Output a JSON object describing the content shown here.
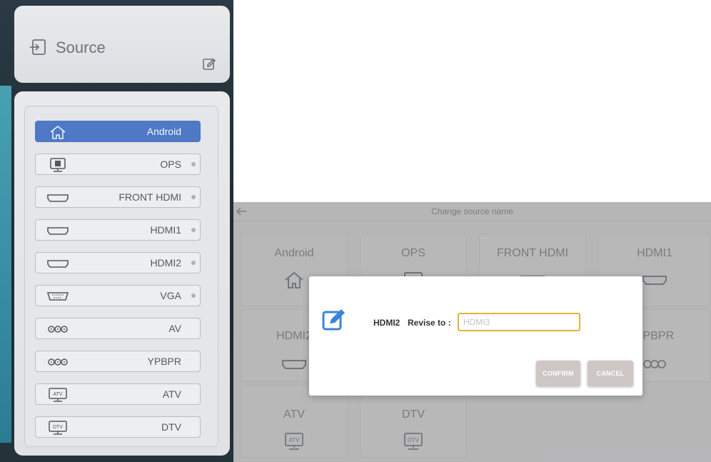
{
  "left_panel": {
    "title": "Source",
    "items": [
      {
        "label": "Android",
        "icon": "home-icon",
        "active": true
      },
      {
        "label": "OPS",
        "icon": "monitor-icon",
        "active": false
      },
      {
        "label": "FRONT HDMI",
        "icon": "hdmi-port-icon",
        "active": false
      },
      {
        "label": "HDMI1",
        "icon": "hdmi-port-icon",
        "active": false
      },
      {
        "label": "HDMI2",
        "icon": "hdmi-port-icon",
        "active": false
      },
      {
        "label": "VGA",
        "icon": "vga-port-icon",
        "active": false
      },
      {
        "label": "AV",
        "icon": "av-ports-icon",
        "active": false
      },
      {
        "label": "YPBPR",
        "icon": "av-ports-icon",
        "active": false
      },
      {
        "label": "ATV",
        "icon": "atv-icon",
        "active": false
      },
      {
        "label": "DTV",
        "icon": "dtv-icon",
        "active": false
      }
    ]
  },
  "change_screen": {
    "title": "Change source name",
    "tiles": [
      {
        "label": "Android",
        "icon": "home-icon"
      },
      {
        "label": "OPS",
        "icon": "monitor-icon"
      },
      {
        "label": "FRONT HDMI",
        "icon": "hdmi-port-icon"
      },
      {
        "label": "HDMI1",
        "icon": "hdmi-port-icon"
      },
      {
        "label": "HDMI2",
        "icon": "hdmi-port-icon"
      },
      {
        "label": "YPBPR",
        "icon": "av-ports-icon"
      },
      {
        "label": "ATV",
        "icon": "atv-icon"
      },
      {
        "label": "DTV",
        "icon": "dtv-icon"
      }
    ],
    "icon_labels": {
      "atv": "ATV",
      "dtv": "DTV"
    }
  },
  "dialog": {
    "source_name": "HDMI2",
    "revise_label": "Revise to :",
    "input_value": "",
    "input_placeholder": "HDMI3",
    "confirm_label": "CONFIRM",
    "cancel_label": "CANCEL"
  },
  "colors": {
    "active_item": "#4f79c4",
    "input_border": "#e2b43a",
    "edit_icon": "#3a86d6"
  }
}
